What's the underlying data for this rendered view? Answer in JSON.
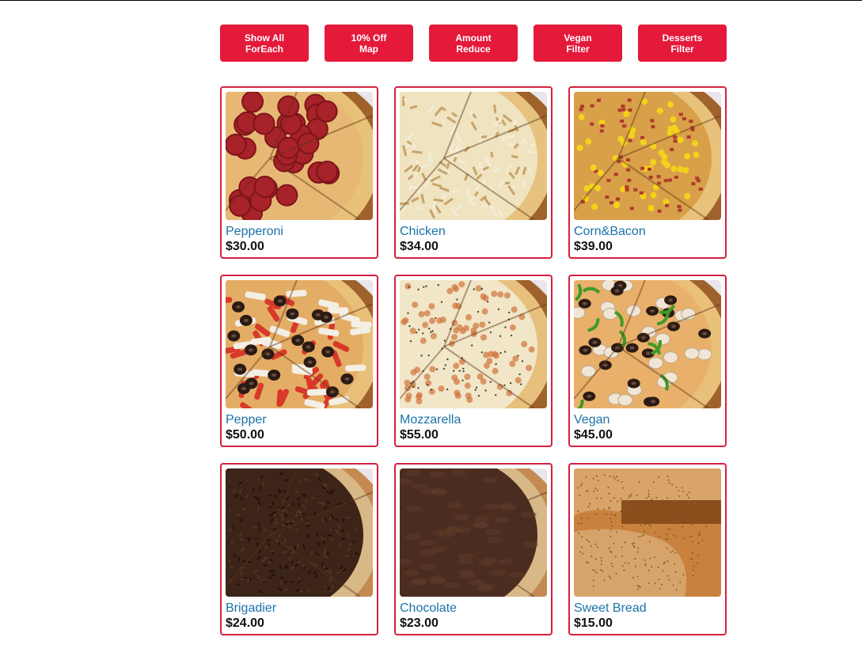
{
  "buttons": [
    {
      "line1": "Show All",
      "line2": "ForEach"
    },
    {
      "line1": "10% Off",
      "line2": "Map"
    },
    {
      "line1": "Amount",
      "line2": "Reduce"
    },
    {
      "line1": "Vegan",
      "line2": "Filter"
    },
    {
      "line1": "Desserts",
      "line2": "Filter"
    }
  ],
  "products": [
    {
      "name": "Pepperoni",
      "price": "$30.00",
      "kind": "pepperoni"
    },
    {
      "name": "Chicken",
      "price": "$34.00",
      "kind": "chicken"
    },
    {
      "name": "Corn&Bacon",
      "price": "$39.00",
      "kind": "cornbacon"
    },
    {
      "name": "Pepper",
      "price": "$50.00",
      "kind": "pepper"
    },
    {
      "name": "Mozzarella",
      "price": "$55.00",
      "kind": "mozzarella"
    },
    {
      "name": "Vegan",
      "price": "$45.00",
      "kind": "vegan"
    },
    {
      "name": "Brigadier",
      "price": "$24.00",
      "kind": "brigadier"
    },
    {
      "name": "Chocolate",
      "price": "$23.00",
      "kind": "chocolate"
    },
    {
      "name": "Sweet Bread",
      "price": "$15.00",
      "kind": "sweetbread"
    }
  ],
  "colors": {
    "accent": "#e5193a",
    "card_border": "#d6203f",
    "name_text": "#1a73a8"
  }
}
